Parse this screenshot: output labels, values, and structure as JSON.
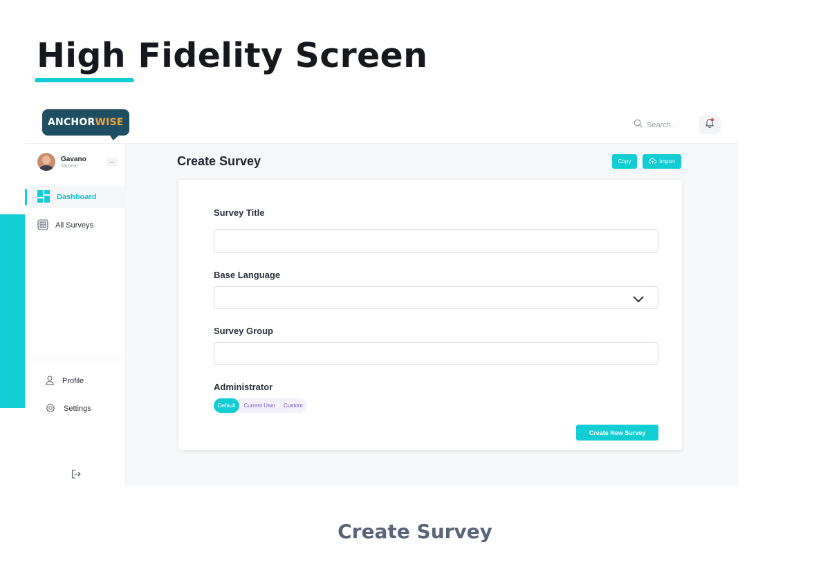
{
  "heading": "High Fidelity Screen",
  "caption": "Create Survey",
  "brand": {
    "logo_part1": "ANCHOR",
    "logo_part2": "WISE"
  },
  "header": {
    "search_placeholder": "Search..."
  },
  "user": {
    "name": "Gavano",
    "subtitle": "Micheal",
    "more": "..."
  },
  "sidebar": {
    "items": [
      {
        "label": "Dashboard",
        "icon": "dashboard-icon",
        "active": true
      },
      {
        "label": "All Surveys",
        "icon": "surveys-icon",
        "active": false
      }
    ],
    "bottom": [
      {
        "label": "Profile",
        "icon": "user-icon"
      },
      {
        "label": "Settings",
        "icon": "gear-icon"
      }
    ]
  },
  "page": {
    "title": "Create Survey",
    "copy_label": "Copy",
    "import_label": "Import"
  },
  "form": {
    "survey_title_label": "Survey Title",
    "survey_title_value": "",
    "base_language_label": "Base Language",
    "base_language_value": "",
    "survey_group_label": "Survey Group",
    "survey_group_value": "",
    "administrator_label": "Administrator",
    "administrator_options": [
      "Default",
      "Current User",
      "Custom"
    ],
    "administrator_selected": "Default",
    "submit_label": "Create New Survey"
  },
  "colors": {
    "accent": "#12cdd3",
    "logo_bg": "#1f4e63",
    "logo_highlight": "#f2a33a",
    "segment_text": "#7f58c9"
  }
}
